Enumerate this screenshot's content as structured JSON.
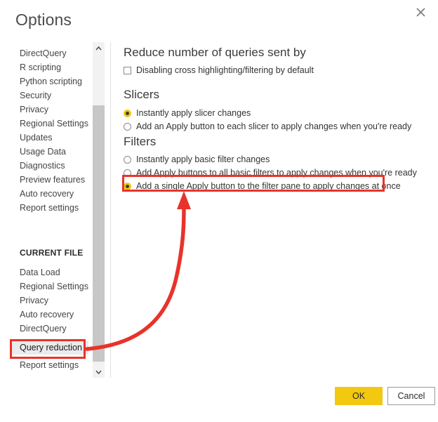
{
  "dialog": {
    "title": "Options",
    "close_icon": "close-x-icon"
  },
  "sidebar": {
    "global_items": [
      {
        "label": "DirectQuery"
      },
      {
        "label": "R scripting"
      },
      {
        "label": "Python scripting"
      },
      {
        "label": "Security"
      },
      {
        "label": "Privacy"
      },
      {
        "label": "Regional Settings"
      },
      {
        "label": "Updates"
      },
      {
        "label": "Usage Data"
      },
      {
        "label": "Diagnostics"
      },
      {
        "label": "Preview features"
      },
      {
        "label": "Auto recovery"
      },
      {
        "label": "Report settings"
      }
    ],
    "group_header": "CURRENT FILE",
    "current_file_items": [
      {
        "label": "Data Load",
        "selected": false
      },
      {
        "label": "Regional Settings",
        "selected": false
      },
      {
        "label": "Privacy",
        "selected": false
      },
      {
        "label": "Auto recovery",
        "selected": false
      },
      {
        "label": "DirectQuery",
        "selected": false
      },
      {
        "label": "Query reduction",
        "selected": true
      },
      {
        "label": "Report settings",
        "selected": false
      }
    ],
    "scrollbar": {
      "up_icon": "chevron-up-icon",
      "down_icon": "chevron-down-icon"
    }
  },
  "main": {
    "sections": [
      {
        "heading": "Reduce number of queries sent by",
        "options": [
          {
            "type": "checkbox",
            "label": "Disabling cross highlighting/filtering by default",
            "checked": false
          }
        ]
      },
      {
        "heading": "Slicers",
        "options": [
          {
            "type": "radio",
            "label": "Instantly apply slicer changes",
            "checked": true
          },
          {
            "type": "radio",
            "label": "Add an Apply button to each slicer to apply changes when you're ready",
            "checked": false
          }
        ]
      },
      {
        "heading": "Filters",
        "options": [
          {
            "type": "radio",
            "label": "Instantly apply basic filter changes",
            "checked": false
          },
          {
            "type": "radio",
            "label": "Add Apply buttons to all basic filters to apply changes when you're ready",
            "checked": false
          },
          {
            "type": "radio",
            "label": "Add a single Apply button to the filter pane to apply changes at once",
            "checked": true
          }
        ]
      }
    ]
  },
  "footer": {
    "ok_label": "OK",
    "cancel_label": "Cancel"
  },
  "annotations": {
    "accent_color": "#e8332a",
    "highlight_color": "#f2c811",
    "sidebar_callout_target": "Query reduction",
    "filter_callout_target": "Add a single Apply button to the filter pane to apply changes at once"
  }
}
